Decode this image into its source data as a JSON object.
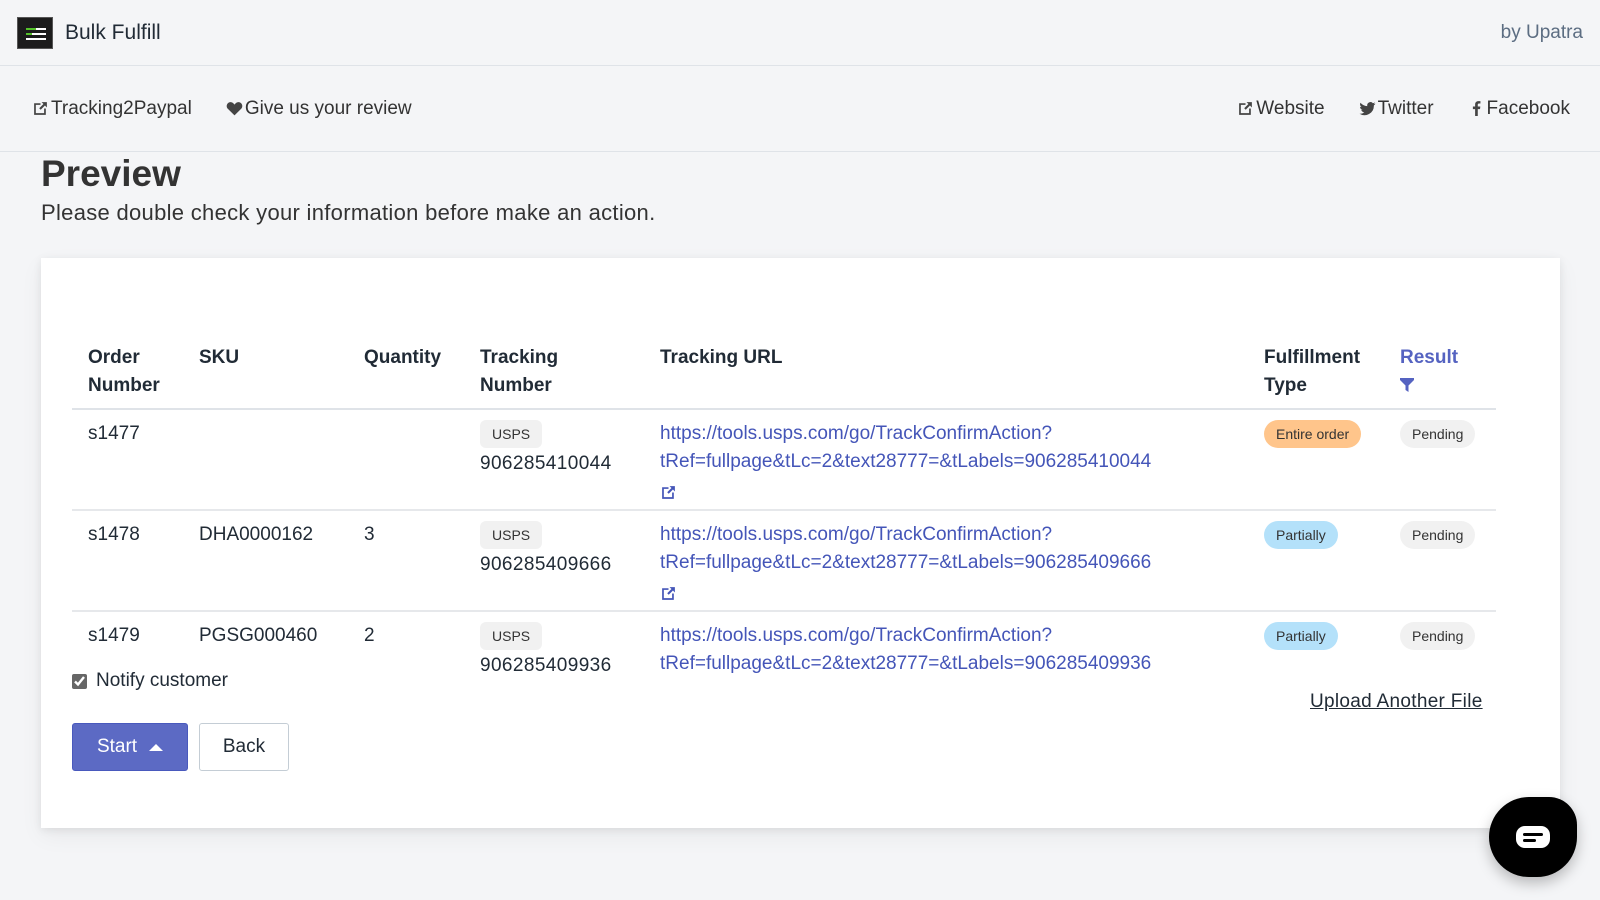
{
  "app": {
    "title": "Bulk Fulfill",
    "byline": "by Upatra"
  },
  "nav": {
    "left": [
      {
        "label": "Tracking2Paypal",
        "icon": "external-link-icon"
      },
      {
        "label": "Give us your review",
        "icon": "heart-icon"
      }
    ],
    "right": [
      {
        "label": "Website",
        "icon": "external-link-icon"
      },
      {
        "label": "Twitter",
        "icon": "twitter-icon"
      },
      {
        "label": "Facebook",
        "icon": "facebook-icon"
      }
    ]
  },
  "page": {
    "title": "Preview",
    "subtitle": "Please double check your information before make an action."
  },
  "table": {
    "headers": {
      "order": "Order Number",
      "sku": "SKU",
      "quantity": "Quantity",
      "tracking": "Tracking Number",
      "url": "Tracking URL",
      "type": "Fulfillment Type",
      "result": "Result"
    },
    "rows": [
      {
        "order": "s1477",
        "sku": "",
        "quantity": "",
        "carrier": "USPS",
        "tracking": "906285410044",
        "url_line1": "https://tools.usps.com/go/TrackConfirmAction?",
        "url_line2": "tRef=fullpage&tLc=2&text28777=&tLabels=906285410044",
        "type": "Entire order",
        "result": "Pending"
      },
      {
        "order": "s1478",
        "sku": "DHA0000162",
        "quantity": "3",
        "carrier": "USPS",
        "tracking": "906285409666",
        "url_line1": "https://tools.usps.com/go/TrackConfirmAction?",
        "url_line2": "tRef=fullpage&tLc=2&text28777=&tLabels=906285409666",
        "type": "Partially",
        "result": "Pending"
      },
      {
        "order": "s1479",
        "sku": "PGSG000460",
        "quantity": "2",
        "carrier": "USPS",
        "tracking": "906285409936",
        "url_line1": "https://tools.usps.com/go/TrackConfirmAction?",
        "url_line2": "tRef=fullpage&tLc=2&text28777=&tLabels=906285409936",
        "type": "Partially",
        "result": "Pending"
      }
    ]
  },
  "form": {
    "notify_label": "Notify customer",
    "notify_checked": true,
    "start_label": "Start",
    "back_label": "Back",
    "upload_label": "Upload Another File"
  },
  "colors": {
    "primary": "#5c6ac4",
    "link": "#4455b8",
    "entire_order": "#ffc58b",
    "partially": "#b4e1fa",
    "pending": "#f1f1f1"
  }
}
